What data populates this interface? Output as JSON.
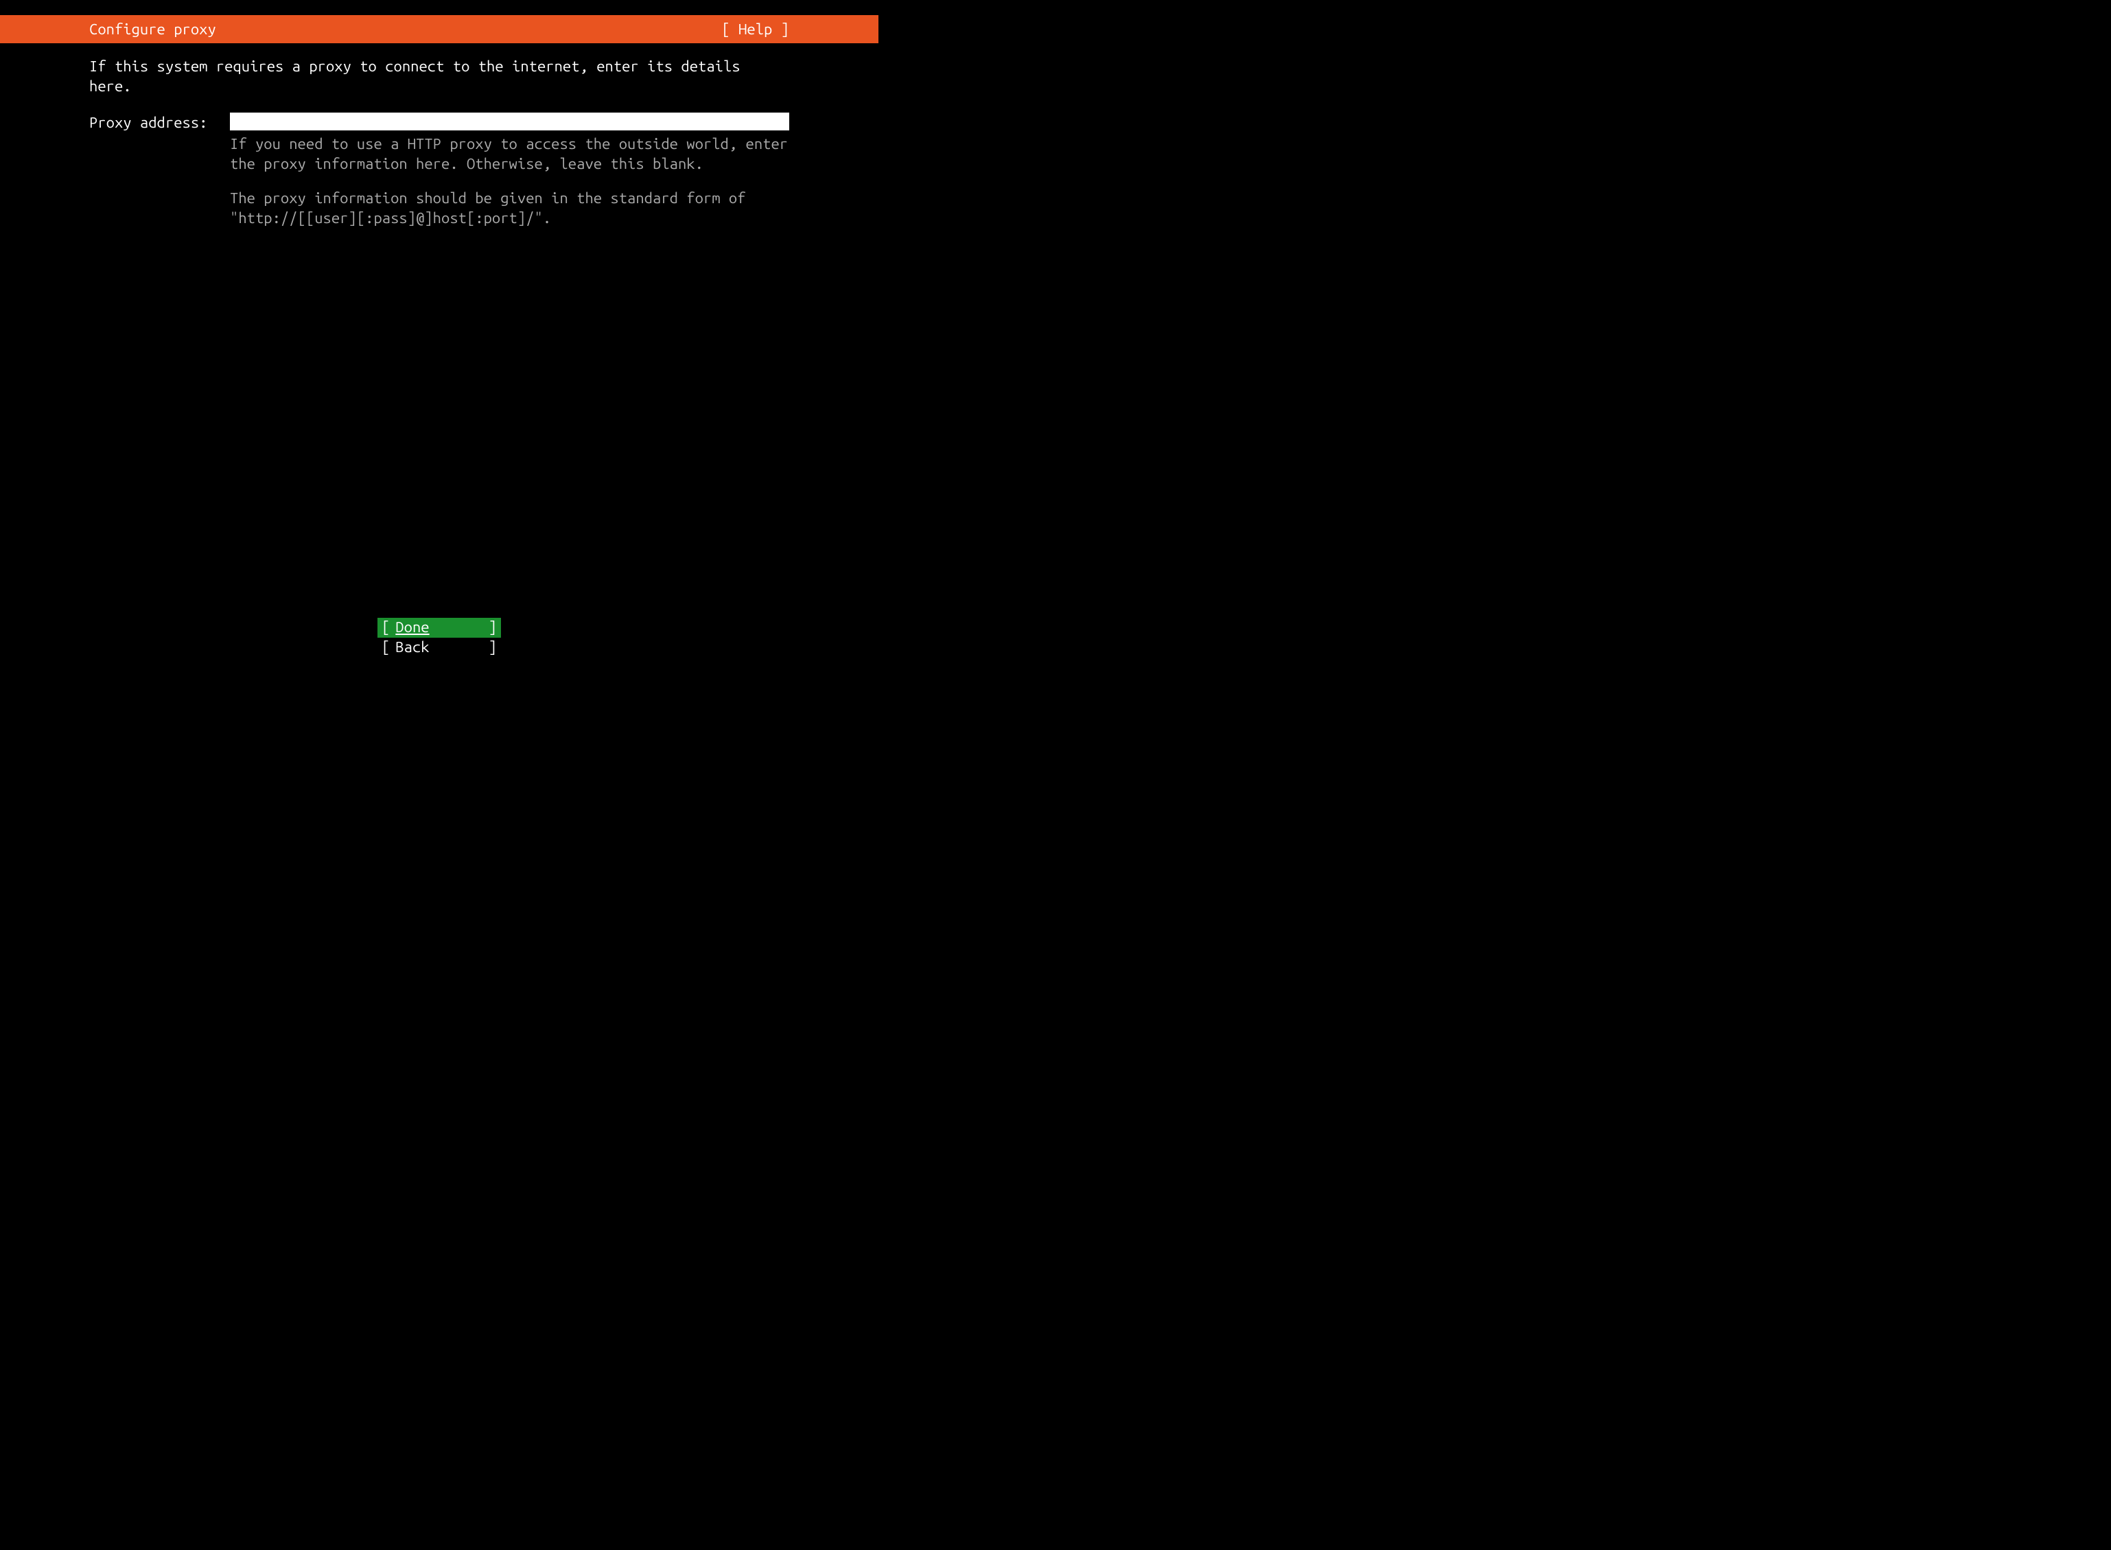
{
  "header": {
    "title": "Configure proxy",
    "help": "[ Help ]"
  },
  "content": {
    "intro": "If this system requires a proxy to connect to the internet, enter its details here.",
    "proxy": {
      "label": "Proxy address:",
      "value": "",
      "help1": "If you need to use a HTTP proxy to access the outside world, enter the proxy information here. Otherwise, leave this blank.",
      "help2": "The proxy information should be given in the standard form of \"http://[[user][:pass]@]host[:port]/\"."
    }
  },
  "footer": {
    "done": "Done",
    "back": "Back"
  }
}
